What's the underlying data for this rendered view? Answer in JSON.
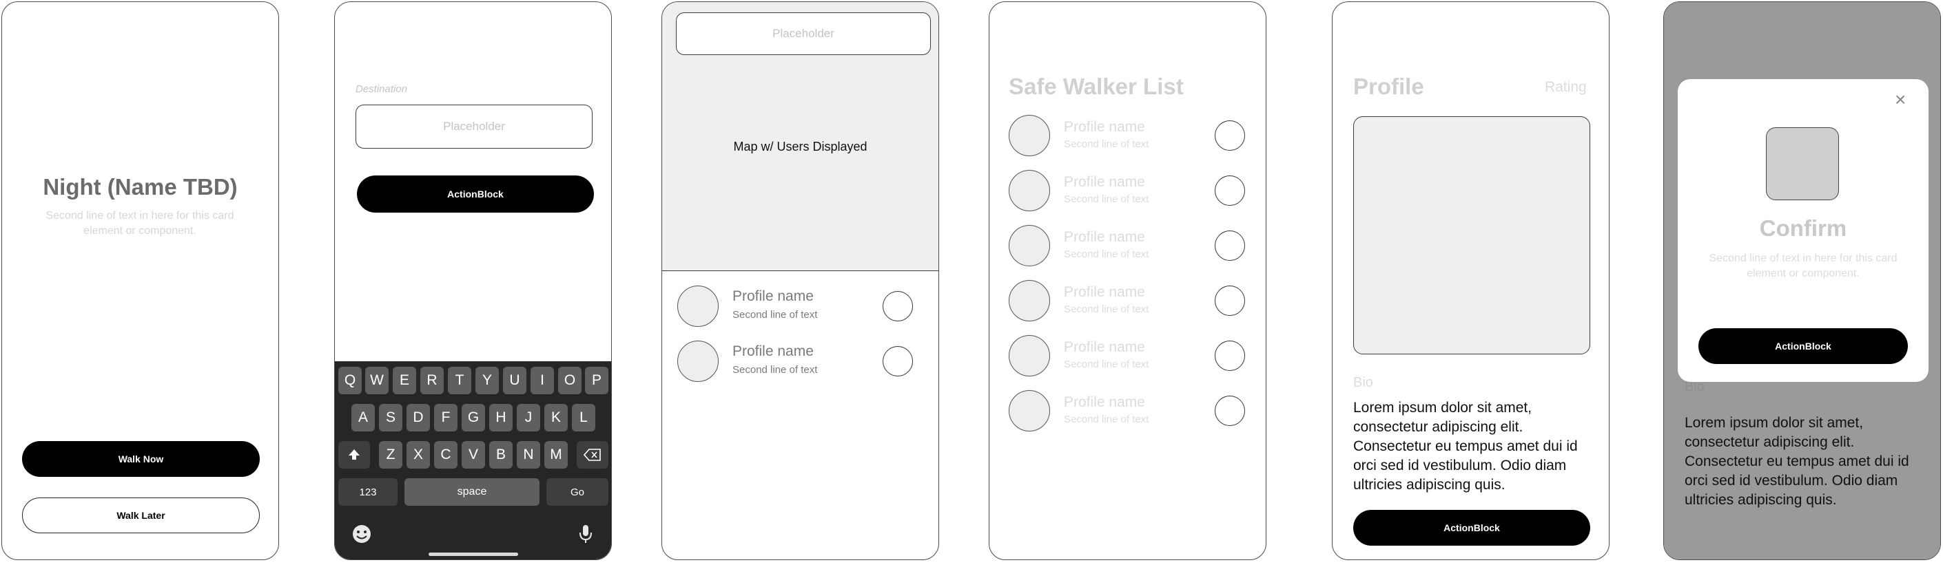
{
  "screen1": {
    "title": "Night (Name TBD)",
    "subtitle": "Second line of text in here for this card element or component.",
    "walk_now": "Walk Now",
    "walk_later": "Walk Later"
  },
  "screen2": {
    "destination_label": "Destination",
    "input_placeholder": "Placeholder",
    "action": "ActionBlock",
    "keyboard": {
      "row1": [
        "Q",
        "W",
        "E",
        "R",
        "T",
        "Y",
        "U",
        "I",
        "O",
        "P"
      ],
      "row2": [
        "A",
        "S",
        "D",
        "F",
        "G",
        "H",
        "J",
        "K",
        "L"
      ],
      "row3": [
        "Z",
        "X",
        "C",
        "V",
        "B",
        "N",
        "M"
      ],
      "numbers": "123",
      "space": "space",
      "go": "Go"
    }
  },
  "screen3": {
    "search_placeholder": "Placeholder",
    "map_label": "Map w/ Users Displayed",
    "items": [
      {
        "name": "Profile name",
        "sub": "Second line of text"
      },
      {
        "name": "Profile name",
        "sub": "Second line of text"
      }
    ]
  },
  "screen4": {
    "title": "Safe Walker List",
    "items": [
      {
        "name": "Profile name",
        "sub": "Second line of text"
      },
      {
        "name": "Profile name",
        "sub": "Second line of text"
      },
      {
        "name": "Profile name",
        "sub": "Second line of text"
      },
      {
        "name": "Profile name",
        "sub": "Second line of text"
      },
      {
        "name": "Profile name",
        "sub": "Second line of text"
      },
      {
        "name": "Profile name",
        "sub": "Second line of text"
      }
    ]
  },
  "screen5": {
    "title": "Profile",
    "rating": "Rating",
    "bio_label": "Bio",
    "bio_text": "Lorem ipsum dolor sit amet, consectetur adipiscing elit. Consectetur eu tempus amet dui id orci sed id vestibulum. Odio diam ultricies adipiscing quis.",
    "action": "ActionBlock"
  },
  "screen6": {
    "close": "×",
    "confirm_title": "Confirm",
    "confirm_sub": "Second line of text in here for this card element or component.",
    "action": "ActionBlock",
    "bio_label": "Bio",
    "bio_text": "Lorem ipsum dolor sit amet, consectetur adipiscing elit. Consectetur eu tempus amet dui id orci sed id vestibulum. Odio diam ultricies adipiscing quis."
  }
}
